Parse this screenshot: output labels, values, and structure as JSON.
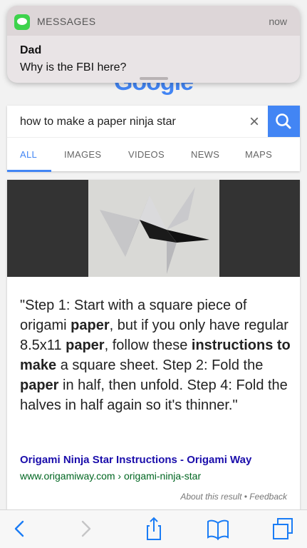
{
  "notification": {
    "app_name": "MESSAGES",
    "time": "now",
    "sender": "Dad",
    "message": "Why is the FBI here?"
  },
  "logo_text": "Google",
  "search": {
    "query": "how to make a paper ninja star",
    "clear_icon": "close-icon",
    "search_icon": "search-icon"
  },
  "tabs": [
    {
      "label": "ALL",
      "active": true
    },
    {
      "label": "IMAGES",
      "active": false
    },
    {
      "label": "VIDEOS",
      "active": false
    },
    {
      "label": "NEWS",
      "active": false
    },
    {
      "label": "MAPS",
      "active": false
    }
  ],
  "result": {
    "snippet_parts": [
      {
        "text": "\"Step 1: Start with a square piece of origami ",
        "bold": false
      },
      {
        "text": "paper",
        "bold": true
      },
      {
        "text": ", but if you only have regular 8.5x11 ",
        "bold": false
      },
      {
        "text": "paper",
        "bold": true
      },
      {
        "text": ", follow these ",
        "bold": false
      },
      {
        "text": "instructions to make",
        "bold": true
      },
      {
        "text": " a square sheet. Step 2: Fold the ",
        "bold": false
      },
      {
        "text": "paper",
        "bold": true
      },
      {
        "text": " in half, then unfold. Step 4: Fold the halves in half again so it's thinner.\"",
        "bold": false
      }
    ],
    "title": "Origami Ninja Star Instructions - Origami Way",
    "url": "www.origamiway.com › origami-ninja-star",
    "footer": "About this result • Feedback"
  },
  "toolbar": {
    "back_icon": "chevron-left-icon",
    "forward_icon": "chevron-right-icon",
    "share_icon": "share-icon",
    "bookmarks_icon": "book-icon",
    "tabs_icon": "tabs-icon"
  },
  "colors": {
    "accent": "#4285f4",
    "link": "#1a0dab",
    "url": "#006621",
    "messages_green": "#3dd34c"
  }
}
